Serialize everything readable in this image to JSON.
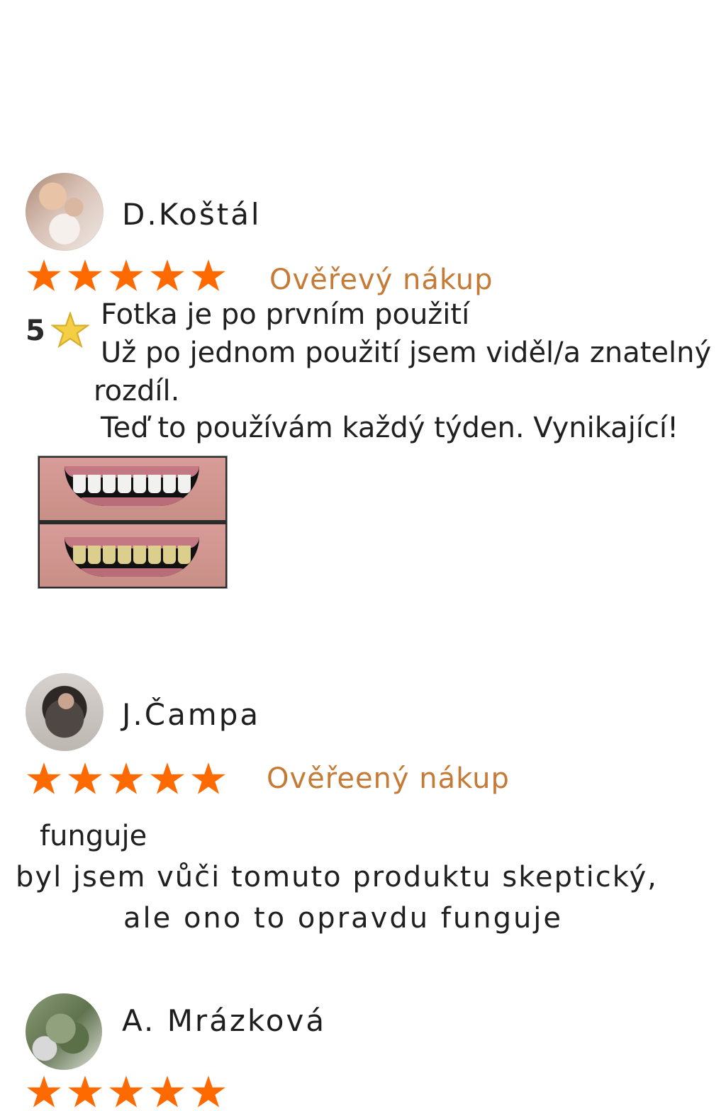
{
  "reviews": [
    {
      "name": "D.Koštál",
      "verified": "Ověřevý nákup",
      "score": "5",
      "lines": [
        "Fotka je po prvním použití",
        "Už po jednom použití jsem viděl/a znatelný",
        "rozdíl.",
        "Teď to používám každý týden. Vynikající!"
      ]
    },
    {
      "name": "J.Čampa",
      "verified": "Ověřeený nákup",
      "lines": [
        "funguje",
        "byl jsem vůči tomuto produktu skeptický,",
        "ale ono to opravdu funguje"
      ]
    },
    {
      "name": "A. Mrázková"
    }
  ],
  "colors": {
    "star": "#ff6a00",
    "verified": "#c57a35",
    "badge_star": "#f4cf45"
  },
  "icons": {
    "rating_star": "star-icon",
    "badge_star": "star-icon"
  }
}
